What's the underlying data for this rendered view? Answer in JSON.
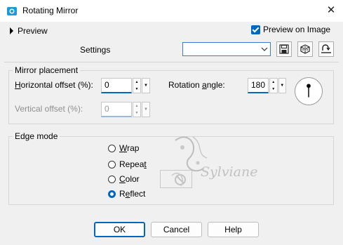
{
  "window": {
    "title": "Rotating Mirror",
    "close_glyph": "✕"
  },
  "toolbar": {
    "preview_label": "Preview",
    "preview_on_image_label": "Preview on Image",
    "preview_on_image_checked": true,
    "settings_label": "Settings",
    "settings_value": "",
    "icons": [
      "save-icon",
      "cube-randomize-icon",
      "reset-icon"
    ]
  },
  "mirror_placement": {
    "group_label": "Mirror placement",
    "horizontal_offset": {
      "label_pre": "",
      "label_ul": "H",
      "label_post": "orizontal offset (%):",
      "value": "0"
    },
    "vertical_offset": {
      "label": "Vertical offset (%):",
      "value": "0",
      "disabled": true
    },
    "rotation_angle": {
      "label_pre": "Rotation ",
      "label_ul": "a",
      "label_post": "ngle:",
      "value": "180"
    }
  },
  "edge_mode": {
    "group_label": "Edge mode",
    "options": [
      {
        "pre": "",
        "ul": "W",
        "post": "rap",
        "selected": false
      },
      {
        "pre": "Repea",
        "ul": "t",
        "post": "",
        "selected": false
      },
      {
        "pre": "",
        "ul": "C",
        "post": "olor",
        "selected": false
      },
      {
        "pre": "R",
        "ul": "e",
        "post": "flect",
        "selected": true
      }
    ]
  },
  "watermark": "Sylviane",
  "buttons": {
    "ok": "OK",
    "cancel": "Cancel",
    "help": "Help"
  },
  "colors": {
    "accent": "#0067c0",
    "background": "#f0f0f0"
  }
}
